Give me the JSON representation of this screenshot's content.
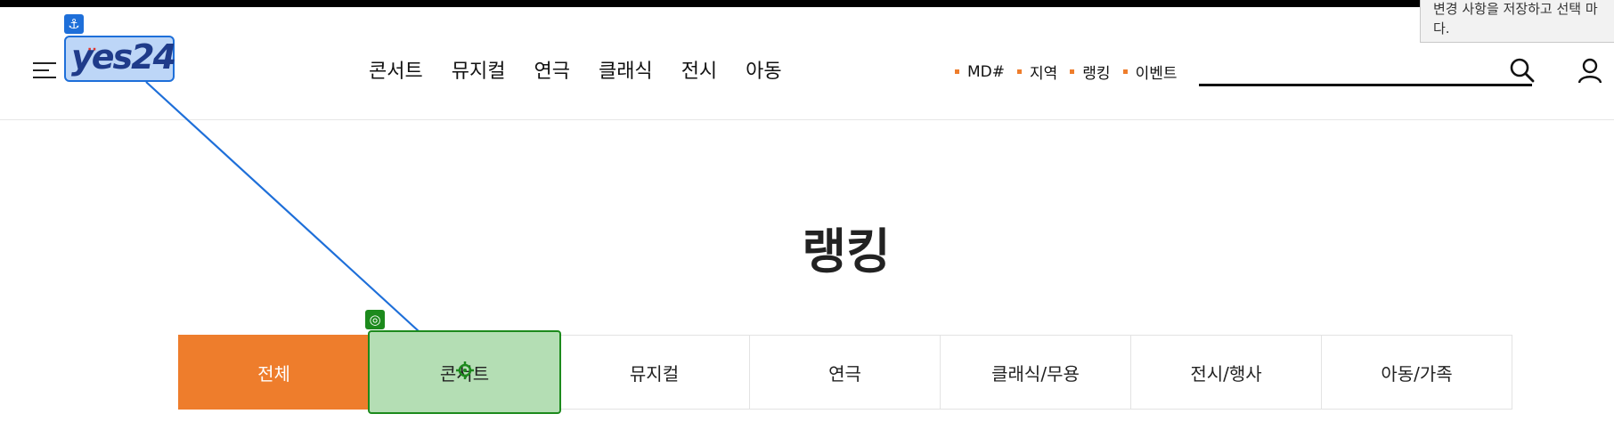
{
  "header": {
    "logo_text": "yes24",
    "logo_dots": "··",
    "nav": [
      "콘서트",
      "뮤지컬",
      "연극",
      "클래식",
      "전시",
      "아동"
    ],
    "quick_links": [
      "MD#",
      "지역",
      "랭킹",
      "이벤트"
    ],
    "search": {
      "placeholder": ""
    }
  },
  "overlay": {
    "tooltip_text": "변경 사항을 저장하고 선택 마\n다.",
    "anchor_icon": "anchor-icon",
    "target_icon": "target-icon"
  },
  "page": {
    "title": "랭킹"
  },
  "tabs": [
    {
      "label": "전체",
      "state": "active"
    },
    {
      "label": "콘서트",
      "state": "selected"
    },
    {
      "label": "뮤지컬",
      "state": ""
    },
    {
      "label": "연극",
      "state": ""
    },
    {
      "label": "클래식/무용",
      "state": ""
    },
    {
      "label": "전시/행사",
      "state": ""
    },
    {
      "label": "아동/가족",
      "state": ""
    }
  ],
  "colors": {
    "accent": "#ee7d2c",
    "selection_blue": "#1e6fd9",
    "selection_green": "#1c8a1c"
  }
}
